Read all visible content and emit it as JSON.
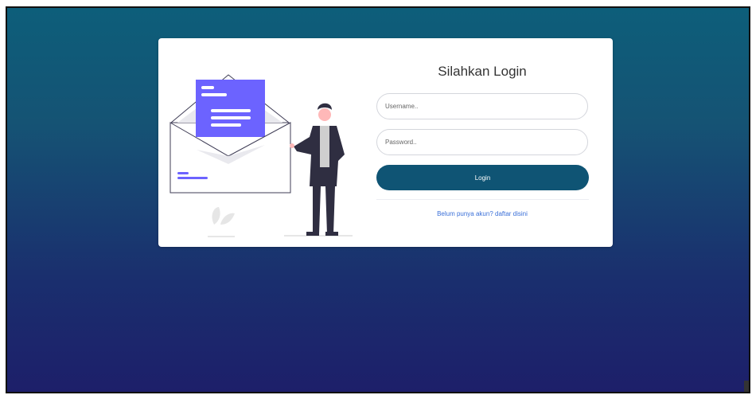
{
  "login": {
    "title": "Silahkan Login",
    "username_placeholder": "Username..",
    "password_placeholder": "Password..",
    "username_value": "",
    "password_value": "",
    "submit_label": "Login",
    "register_link": "Belum punya akun? daftar disini"
  },
  "colors": {
    "accent": "#0f5474",
    "illustration_primary": "#6c63ff",
    "link": "#3a6fd8"
  },
  "illustration": {
    "icon": "envelope-person-illustration"
  }
}
